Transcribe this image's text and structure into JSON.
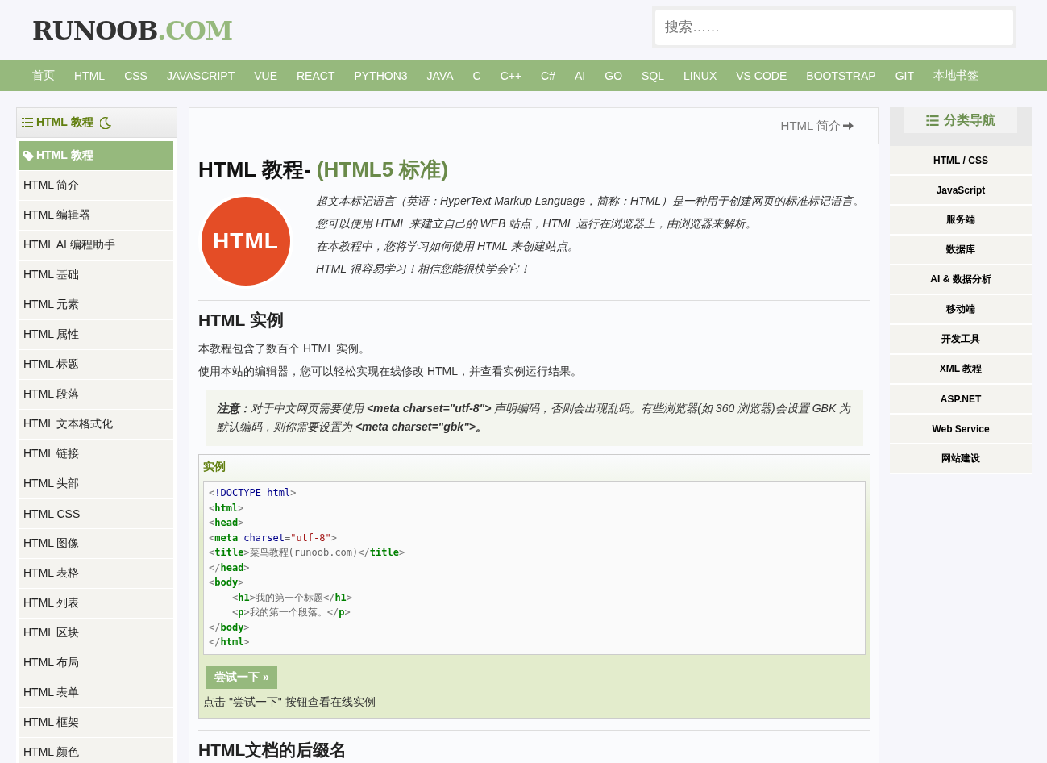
{
  "header": {
    "logo_main": "RUNOOB",
    "logo_suffix": ".COM",
    "search": {
      "placeholder": "搜索……"
    }
  },
  "nav": [
    "首页",
    "HTML",
    "CSS",
    "JAVASCRIPT",
    "VUE",
    "REACT",
    "PYTHON3",
    "JAVA",
    "C",
    "C++",
    "C#",
    "AI",
    "GO",
    "SQL",
    "LINUX",
    "VS CODE",
    "BOOTSTRAP",
    "GIT",
    "本地书签"
  ],
  "sidebar": {
    "title": "HTML 教程",
    "items": [
      {
        "label": "HTML 教程",
        "selected": true
      },
      {
        "label": "HTML 简介",
        "selected": false
      },
      {
        "label": "HTML 编辑器",
        "selected": false
      },
      {
        "label": "HTML AI 编程助手",
        "selected": false
      },
      {
        "label": "HTML 基础",
        "selected": false
      },
      {
        "label": "HTML 元素",
        "selected": false
      },
      {
        "label": "HTML 属性",
        "selected": false
      },
      {
        "label": "HTML 标题",
        "selected": false
      },
      {
        "label": "HTML 段落",
        "selected": false
      },
      {
        "label": "HTML 文本格式化",
        "selected": false
      },
      {
        "label": "HTML 链接",
        "selected": false
      },
      {
        "label": "HTML 头部",
        "selected": false
      },
      {
        "label": "HTML CSS",
        "selected": false
      },
      {
        "label": "HTML 图像",
        "selected": false
      },
      {
        "label": "HTML 表格",
        "selected": false
      },
      {
        "label": "HTML 列表",
        "selected": false
      },
      {
        "label": "HTML 区块",
        "selected": false
      },
      {
        "label": "HTML 布局",
        "selected": false
      },
      {
        "label": "HTML 表单",
        "selected": false
      },
      {
        "label": "HTML 框架",
        "selected": false
      },
      {
        "label": "HTML 颜色",
        "selected": false
      }
    ]
  },
  "article": {
    "next_link": "HTML 简介",
    "title": "HTML 教程-",
    "title_suffix": "(HTML5 标准)",
    "logo_text": "HTML",
    "intro": [
      "超文本标记语言（英语：HyperText Markup Language，简称：HTML）是一种用于创建网页的标准标记语言。",
      "您可以使用 HTML 来建立自己的 WEB 站点，HTML 运行在浏览器上，由浏览器来解析。",
      "在本教程中，您将学习如何使用 HTML 来创建站点。",
      "HTML 很容易学习！相信您能很快学会它！"
    ],
    "section_title": "HTML 实例",
    "paragraphs": [
      "本教程包含了数百个 HTML 实例。",
      "使用本站的编辑器，您可以轻松实现在线修改 HTML，并查看实例运行结果。"
    ],
    "note": "**注意：**对于中文网页需要使用 **<meta charset=\"utf-8\">** 声明编码，否则会出现乱码。有些浏览器(如 360 浏览器)会设置 GBK 为默认编码，则你需要设置为 **<meta charset=\"gbk\">。**",
    "example": {
      "title": "实例",
      "code": [
        {
          "indented": false,
          "tokens": [
            {
              "kind": "punct",
              "text": "<"
            },
            {
              "kind": "keyword",
              "text": "!DOCTYPE html"
            },
            {
              "kind": "punct",
              "text": ">"
            }
          ]
        },
        {
          "indented": false,
          "tokens": [
            {
              "kind": "punct",
              "text": "<"
            },
            {
              "kind": "tag",
              "text": "html"
            },
            {
              "kind": "punct",
              "text": ">"
            }
          ]
        },
        {
          "indented": false,
          "tokens": [
            {
              "kind": "punct",
              "text": "<"
            },
            {
              "kind": "tag",
              "text": "head"
            },
            {
              "kind": "punct",
              "text": ">"
            }
          ]
        },
        {
          "indented": false,
          "tokens": [
            {
              "kind": "punct",
              "text": "<"
            },
            {
              "kind": "tag",
              "text": "meta"
            },
            {
              "kind": "keyword",
              "text": " charset"
            },
            {
              "kind": "text",
              "text": "="
            },
            {
              "kind": "string",
              "text": "\"utf-8\""
            },
            {
              "kind": "punct",
              "text": ">"
            }
          ]
        },
        {
          "indented": false,
          "tokens": [
            {
              "kind": "punct",
              "text": "<"
            },
            {
              "kind": "tag",
              "text": "title"
            },
            {
              "kind": "punct",
              "text": ">"
            },
            {
              "kind": "text",
              "text": "菜鸟教程(runoob.com)"
            },
            {
              "kind": "punct",
              "text": "</"
            },
            {
              "kind": "tag",
              "text": "title"
            },
            {
              "kind": "punct",
              "text": ">"
            }
          ]
        },
        {
          "indented": false,
          "tokens": [
            {
              "kind": "punct",
              "text": "</"
            },
            {
              "kind": "tag",
              "text": "head"
            },
            {
              "kind": "punct",
              "text": ">"
            }
          ]
        },
        {
          "indented": false,
          "tokens": [
            {
              "kind": "punct",
              "text": "<"
            },
            {
              "kind": "tag",
              "text": "body"
            },
            {
              "kind": "punct",
              "text": ">"
            }
          ]
        },
        {
          "indented": true,
          "tokens": [
            {
              "kind": "punct",
              "text": "<"
            },
            {
              "kind": "tag",
              "text": "h1"
            },
            {
              "kind": "punct",
              "text": ">"
            },
            {
              "kind": "text",
              "text": "我的第一个标题"
            },
            {
              "kind": "punct",
              "text": "</"
            },
            {
              "kind": "tag",
              "text": "h1"
            },
            {
              "kind": "punct",
              "text": ">"
            }
          ]
        },
        {
          "indented": true,
          "tokens": [
            {
              "kind": "punct",
              "text": "<"
            },
            {
              "kind": "tag",
              "text": "p"
            },
            {
              "kind": "punct",
              "text": ">"
            },
            {
              "kind": "text",
              "text": "我的第一个段落。"
            },
            {
              "kind": "punct",
              "text": "</"
            },
            {
              "kind": "tag",
              "text": "p"
            },
            {
              "kind": "punct",
              "text": ">"
            }
          ]
        },
        {
          "indented": false,
          "tokens": [
            {
              "kind": "punct",
              "text": "</"
            },
            {
              "kind": "tag",
              "text": "body"
            },
            {
              "kind": "punct",
              "text": ">"
            }
          ]
        },
        {
          "indented": false,
          "tokens": [
            {
              "kind": "punct",
              "text": "</"
            },
            {
              "kind": "tag",
              "text": "html"
            },
            {
              "kind": "punct",
              "text": ">"
            }
          ]
        }
      ],
      "button": "尝试一下 »",
      "hint": "点击 \"尝试一下\" 按钮查看在线实例"
    },
    "section2_title": "HTML文档的后缀名"
  },
  "category_nav": {
    "title": "分类导航",
    "items": [
      "HTML / CSS",
      "JavaScript",
      "服务端",
      "数据库",
      "AI & 数据分析",
      "移动端",
      "开发工具",
      "XML 教程",
      "ASP.NET",
      "Web Service",
      "网站建设"
    ]
  }
}
